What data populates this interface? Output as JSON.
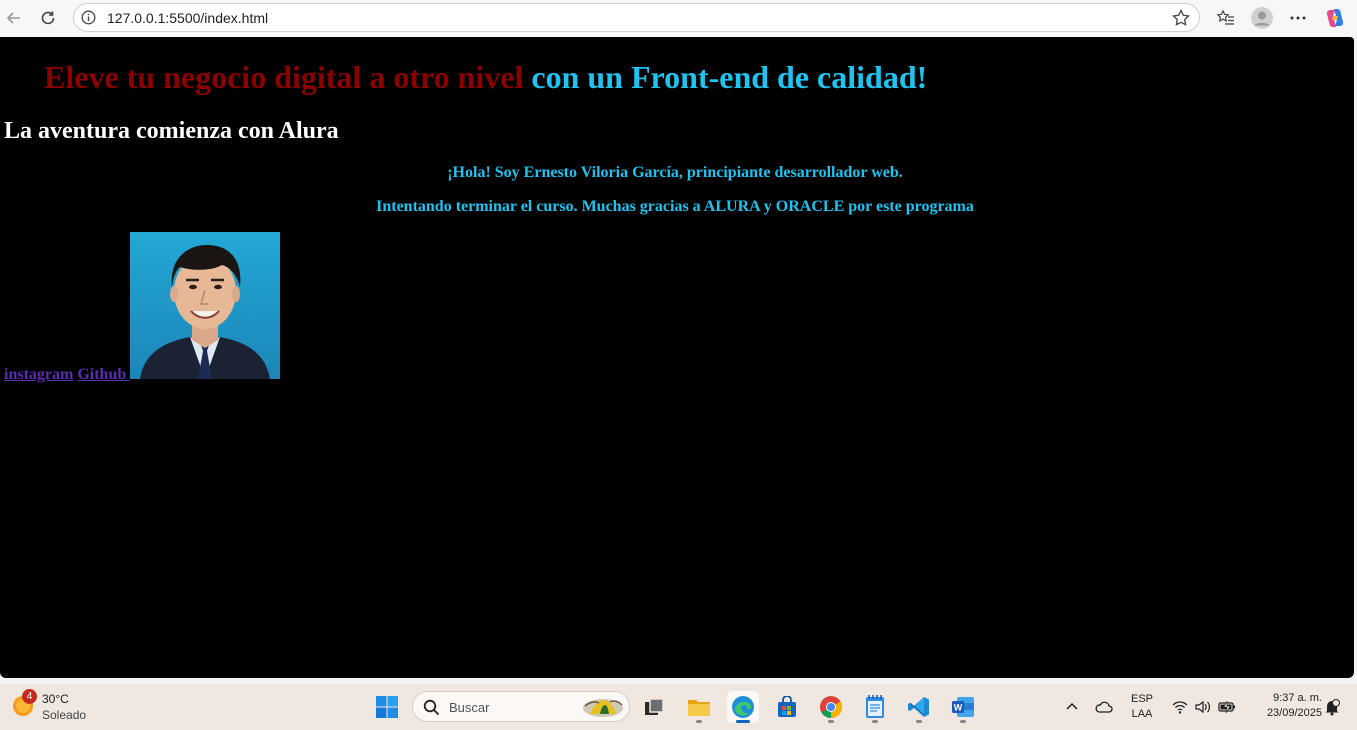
{
  "browser": {
    "url": "127.0.0.1:5500/index.html"
  },
  "page": {
    "heading_red": "Eleve tu negocio digital a otro nivel",
    "heading_cyan": "con un Front-end de calidad!",
    "subheading": "La aventura comienza con Alura",
    "paragraph1": "¡Hola! Soy Ernesto Viloria García, principiante desarrollador web.",
    "paragraph2": "Intentando terminar el curso. Muchas gracias a ALURA y ORACLE por este programa",
    "link_instagram": "instagram",
    "link_github": "Github"
  },
  "taskbar": {
    "weather_badge": "4",
    "weather_temp": "30°C",
    "weather_desc": "Soleado",
    "search_placeholder": "Buscar",
    "lang_top": "ESP",
    "lang_bottom": "LAA",
    "time": "9:37 a. m.",
    "date": "23/09/2025"
  },
  "colors": {
    "heading_red": "#8b0000",
    "accent_cyan": "#1fc3f0",
    "link_purple": "#5b2bb0",
    "page_bg": "#000000"
  }
}
